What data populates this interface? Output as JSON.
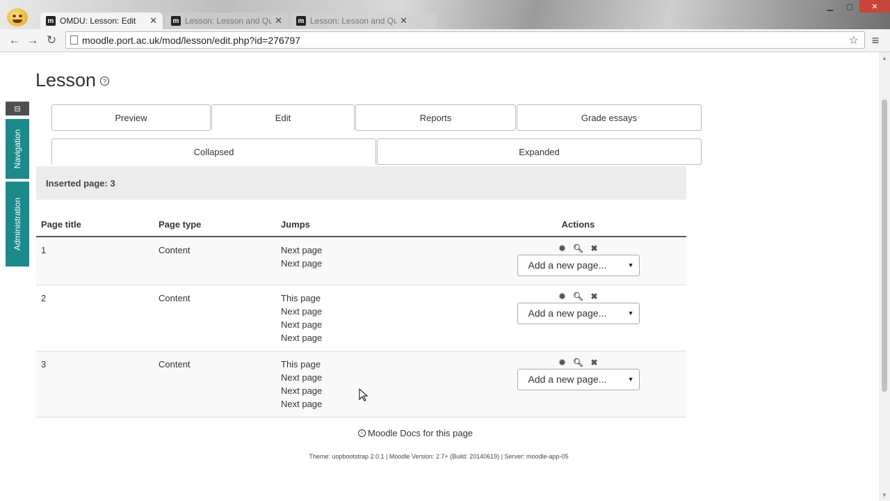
{
  "browser": {
    "tabs": [
      {
        "title": "OMDU: Lesson: Edit",
        "active": true
      },
      {
        "title": "Lesson: Lesson and Quiz Demo",
        "active": false
      },
      {
        "title": "Lesson: Lesson and Quiz Demo",
        "active": false
      }
    ],
    "url": "moodle.port.ac.uk/mod/lesson/edit.php?id=276797",
    "favicon_letter": "m"
  },
  "dock": {
    "navigation": "Navigation",
    "administration": "Administration"
  },
  "page": {
    "title": "Lesson",
    "tabs_top": [
      "Preview",
      "Edit",
      "Reports",
      "Grade essays"
    ],
    "tabs_view": [
      "Collapsed",
      "Expanded"
    ],
    "notice": "Inserted page: 3"
  },
  "table": {
    "headers": [
      "Page title",
      "Page type",
      "Jumps",
      "Actions"
    ],
    "rows": [
      {
        "title": "1",
        "type": "Content",
        "jumps": [
          "Next page",
          "Next page"
        ],
        "add": "Add a new page..."
      },
      {
        "title": "2",
        "type": "Content",
        "jumps": [
          "This page",
          "Next page",
          "Next page",
          "Next page"
        ],
        "add": "Add a new page..."
      },
      {
        "title": "3",
        "type": "Content",
        "jumps": [
          "This page",
          "Next page",
          "Next page",
          "Next page"
        ],
        "add": "Add a new page..."
      }
    ]
  },
  "footer": {
    "docs": "Moodle Docs for this page",
    "info": "Theme: uopbootstrap 2.0.1 | Moodle Version: 2.7+ (Build: 20140619) | Server: moodle-app-05"
  }
}
